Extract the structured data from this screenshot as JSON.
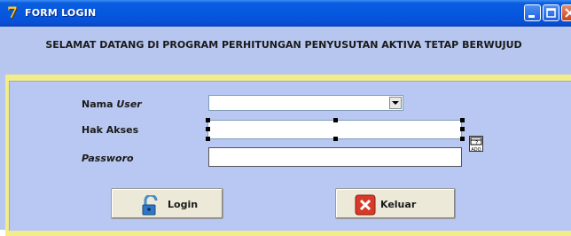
{
  "window": {
    "title": "FORM LOGIN"
  },
  "header": {
    "text": "SELAMAT DATANG DI PROGRAM PERHITUNGAN PENYUSUTAN AKTIVA TETAP BERWUJUD"
  },
  "form": {
    "user_label_prefix": "Nama ",
    "user_label_italic": "User",
    "user_value": "",
    "hak_label": "Hak Akses",
    "hak_value": "",
    "password_label": "Passworo",
    "password_value": "",
    "mini_icon_text": "ADO"
  },
  "buttons": {
    "login": "Login",
    "keluar": "Keluar"
  },
  "colors": {
    "titlebar": "#0558e0",
    "body": "#b8c8f2",
    "frame": "#f2ec8a",
    "close": "#c8431e"
  }
}
